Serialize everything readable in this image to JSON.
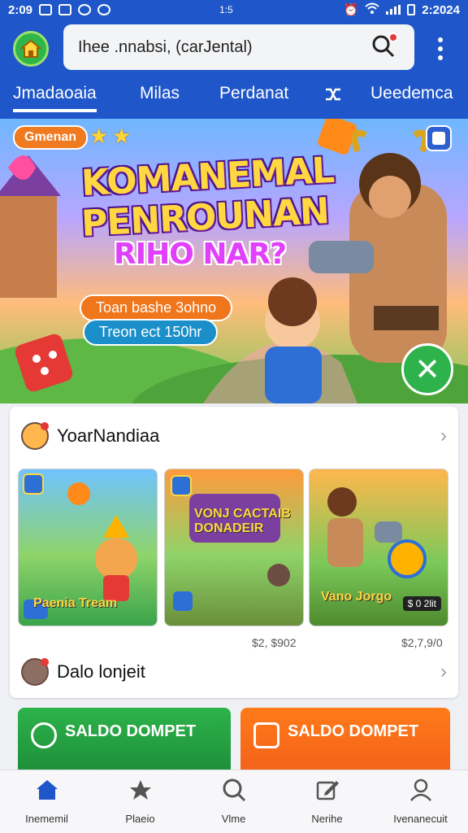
{
  "status_bar": {
    "time": "2:09",
    "center": "1:5",
    "right_time": "2:2024"
  },
  "search": {
    "placeholder": "Ihee .nnabsi, (carJental)"
  },
  "tabs": [
    {
      "label": "Jmadaoaia",
      "active": true
    },
    {
      "label": "Milas",
      "active": false
    },
    {
      "label": "Perdanat",
      "active": false
    },
    {
      "label": "",
      "icon": "shuffle-icon",
      "active": false
    },
    {
      "label": "Ueedemca",
      "active": false
    }
  ],
  "hero": {
    "tag": "Gmenan",
    "title_line1": "KOMANEMAL",
    "title_line2": "PENROUNAN",
    "title_line3": "RIHO NAR?",
    "pill_1": "Toan bashe 3ohno",
    "pill_2": "Treon ect 150hr"
  },
  "section_1": {
    "title": "YoarNandiaa",
    "tiles": [
      {
        "label": "Paenia Tream",
        "price": ""
      },
      {
        "label": "VONJ CACTAIB DONADEIR",
        "price": "$2, $902"
      },
      {
        "label": "Vano Jorgo",
        "tag": "$ 0 2lit",
        "price": "$2,7,9/0"
      }
    ]
  },
  "section_2": {
    "title": "Dalo lonjeit"
  },
  "promos": [
    {
      "label": "SALDO DOMPET",
      "color": "#2db34a"
    },
    {
      "label": "SALDO DOMPET",
      "color": "#ff7a1a"
    }
  ],
  "bottom_nav": [
    {
      "label": "Inememil",
      "icon": "home-icon",
      "active": true
    },
    {
      "label": "Plaeio",
      "icon": "star-icon",
      "active": false
    },
    {
      "label": "Vlme",
      "icon": "search-icon",
      "active": false
    },
    {
      "label": "Nerihe",
      "icon": "edit-icon",
      "active": false
    },
    {
      "label": "Ivenanecuit",
      "icon": "profile-icon",
      "active": false
    }
  ],
  "colors": {
    "primary": "#1f56c9",
    "accent_green": "#2eb24b",
    "accent_orange": "#f0761c"
  }
}
